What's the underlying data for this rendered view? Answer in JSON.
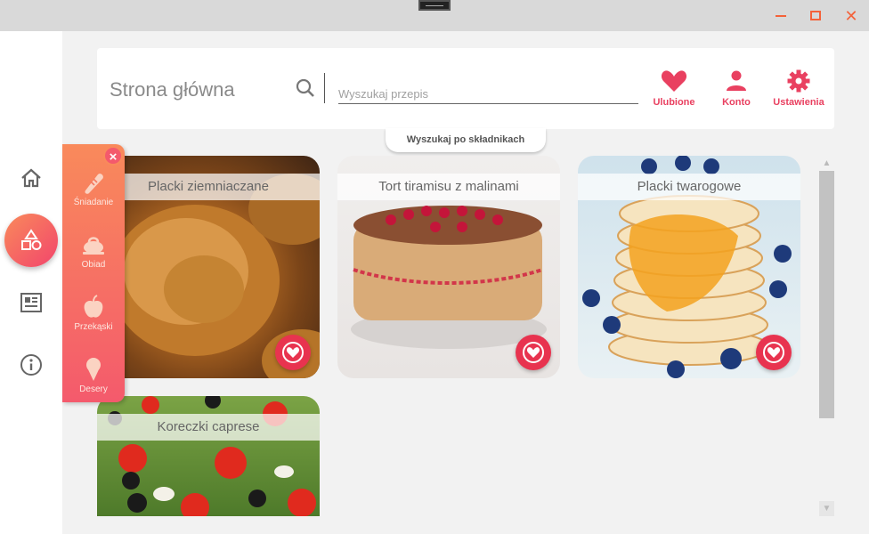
{
  "header": {
    "title": "Strona główna",
    "search_placeholder": "Wyszukaj przepis",
    "actions": [
      {
        "label": "Ulubione",
        "icon": "heart-icon"
      },
      {
        "label": "Konto",
        "icon": "person-icon"
      },
      {
        "label": "Ustawienia",
        "icon": "gear-icon"
      }
    ]
  },
  "ingredient_search_label": "Wyszukaj po składnikach",
  "categories": [
    {
      "label": "Śniadanie",
      "icon": "bread-icon"
    },
    {
      "label": "Obiad",
      "icon": "roast-chicken-icon"
    },
    {
      "label": "Przekąski",
      "icon": "apple-icon"
    },
    {
      "label": "Desery",
      "icon": "ice-cream-icon"
    }
  ],
  "recipes": [
    {
      "title": "Placki ziemniaczane",
      "favorite": true
    },
    {
      "title": "Tort tiramisu z malinami",
      "favorite": true
    },
    {
      "title": "Placki twarogowe",
      "favorite": true
    },
    {
      "title": "Koreczki caprese",
      "favorite": false
    }
  ],
  "sidebar_nav": [
    {
      "icon": "home-icon"
    },
    {
      "icon": "shapes-icon",
      "active": true
    },
    {
      "icon": "recipe-book-icon"
    },
    {
      "icon": "info-icon"
    }
  ],
  "colors": {
    "accent": "#e8334f",
    "gradient_start": "#f98a5b",
    "gradient_end": "#f2456c",
    "window_controls": "#f4623a"
  }
}
